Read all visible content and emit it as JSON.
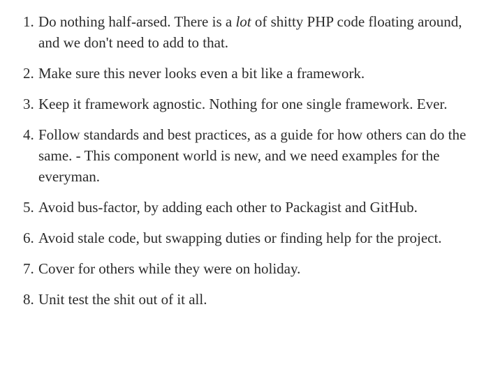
{
  "list": {
    "items": [
      {
        "number": "1.",
        "text_before": "Do nothing half-arsed. There is a ",
        "emphasis": "lot",
        "text_after": " of shitty PHP code floating around, and we don't need to add to that."
      },
      {
        "number": "2.",
        "text": "Make sure this never looks even a bit like a framework."
      },
      {
        "number": "3.",
        "text": "Keep it framework agnostic. Nothing for one single framework. Ever."
      },
      {
        "number": "4.",
        "text": "Follow standards and best practices, as a guide for how others can do the same. - This component world is new, and we need examples for the everyman."
      },
      {
        "number": "5.",
        "text": "Avoid bus-factor, by adding each other to Packagist and GitHub."
      },
      {
        "number": "6.",
        "text": "Avoid stale code, but swapping duties or finding help for the project."
      },
      {
        "number": "7.",
        "text": "Cover for others while they were on holiday."
      },
      {
        "number": "8.",
        "text": "Unit test the shit out of it all."
      }
    ]
  }
}
